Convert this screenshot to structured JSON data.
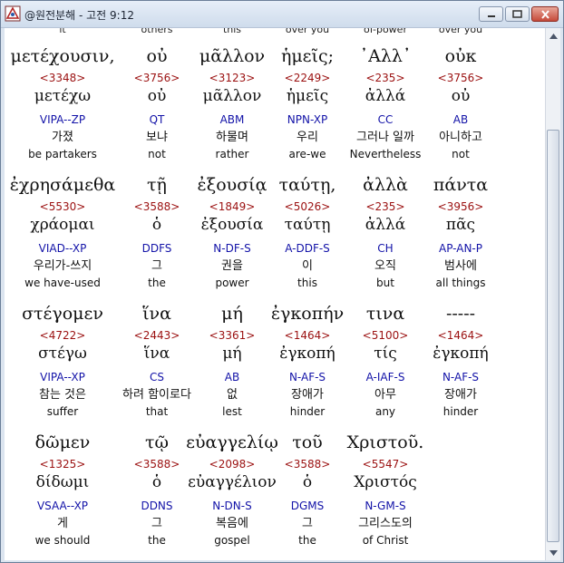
{
  "window": {
    "title": "@원전분해 - 고전 9:12"
  },
  "partial_top": [
    "it",
    "others",
    "this",
    "over you",
    "of-power",
    "over you"
  ],
  "blocks": [
    {
      "greek": [
        "μετέχουσιν,",
        "οὐ",
        "μᾶλλον",
        "ἡμεῖς;",
        "᾿Αλλ᾿",
        "οὐκ"
      ],
      "strongs": [
        "<3348>",
        "<3756>",
        "<3123>",
        "<2249>",
        "<235>",
        "<3756>"
      ],
      "lemma": [
        "μετέχω",
        "οὐ",
        "μᾶλλον",
        "ἡμεῖς",
        "ἀλλά",
        "οὐ"
      ],
      "parsing": [
        "VIPA--ZP",
        "QT",
        "ABM",
        "NPN-XP",
        "CC",
        "AB"
      ],
      "korean": [
        "가졌",
        "보냐",
        "하물며",
        "우리",
        "그러나 일까",
        "아니하고"
      ],
      "english": [
        "be partakers",
        "not",
        "rather",
        "are-we",
        "Nevertheless",
        "not"
      ]
    },
    {
      "greek": [
        "ἐχρησάμεθα",
        "τῇ",
        "ἐξουσίᾳ",
        "ταύτῃ,",
        "ἀλλὰ",
        "πάντα"
      ],
      "strongs": [
        "<5530>",
        "<3588>",
        "<1849>",
        "<5026>",
        "<235>",
        "<3956>"
      ],
      "lemma": [
        "χράομαι",
        "ὁ",
        "ἐξουσία",
        "ταύτῃ",
        "ἀλλά",
        "πᾶς"
      ],
      "parsing": [
        "VIAD--XP",
        "DDFS",
        "N-DF-S",
        "A-DDF-S",
        "CH",
        "AP-AN-P"
      ],
      "korean": [
        "우리가-쓰지",
        "그",
        "권을",
        "이",
        "오직",
        "범사에"
      ],
      "english": [
        "we have-used",
        "the",
        "power",
        "this",
        "but",
        "all things"
      ]
    },
    {
      "greek": [
        "στέγομεν",
        "ἵνα",
        "μή",
        "ἐγκοπήν",
        "τινα",
        "-----"
      ],
      "strongs": [
        "<4722>",
        "<2443>",
        "<3361>",
        "<1464>",
        "<5100>",
        "<1464>"
      ],
      "lemma": [
        "στέγω",
        "ἵνα",
        "μή",
        "ἐγκοπή",
        "τίς",
        "ἐγκοπή"
      ],
      "parsing": [
        "VIPA--XP",
        "CS",
        "AB",
        "N-AF-S",
        "A-IAF-S",
        "N-AF-S"
      ],
      "korean": [
        "참는 것은",
        "하려 함이로다",
        "없",
        "장애가",
        "아무",
        "장애가"
      ],
      "english": [
        "suffer",
        "that",
        "lest",
        "hinder",
        "any",
        "hinder"
      ]
    },
    {
      "greek": [
        "δῶμεν",
        "τῷ",
        "εὐαγγελίῳ",
        "τοῦ",
        "Χριστοῦ."
      ],
      "strongs": [
        "<1325>",
        "<3588>",
        "<2098>",
        "<3588>",
        "<5547>"
      ],
      "lemma": [
        "δίδωμι",
        "ὁ",
        "εὐαγγέλιον",
        "ὁ",
        "Χριστός"
      ],
      "parsing": [
        "VSAA--XP",
        "DDNS",
        "N-DN-S",
        "DGMS",
        "N-GM-S"
      ],
      "korean": [
        "게",
        "그",
        "복음에",
        "그",
        "그리스도의"
      ],
      "english": [
        "we should",
        "the",
        "gospel",
        "the",
        "of Christ"
      ]
    }
  ]
}
